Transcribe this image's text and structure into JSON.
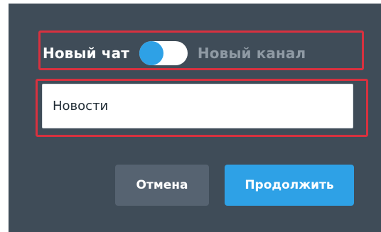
{
  "dialog": {
    "toggle": {
      "left_label": "Новый чат",
      "right_label": "Новый канал",
      "state": "left"
    },
    "name_input": {
      "value": "Новости",
      "placeholder": ""
    },
    "buttons": {
      "cancel_label": "Отмена",
      "continue_label": "Продолжить"
    }
  },
  "colors": {
    "background": "#3f4c58",
    "accent": "#2ea1e6",
    "cancel_button": "#566371",
    "inactive_label": "#8f9aa4",
    "highlight_frame": "#d8313f"
  },
  "icons": {
    "toggle": "toggle-switch-icon"
  }
}
